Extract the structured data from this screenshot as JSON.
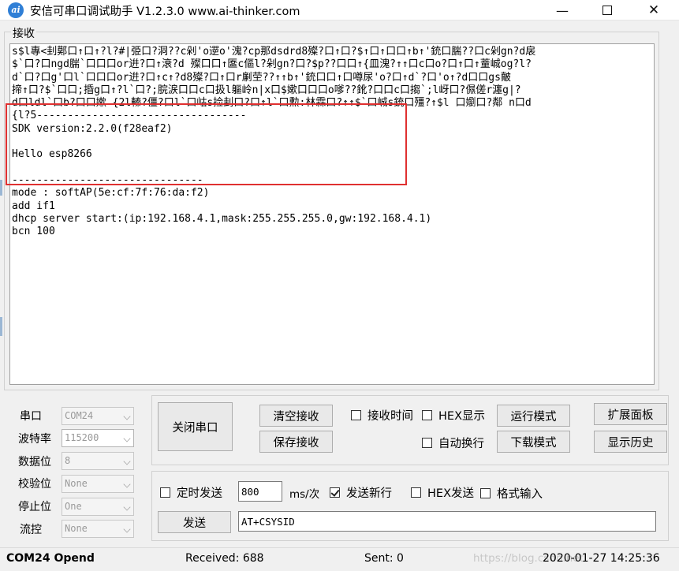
{
  "window": {
    "title": "安信可串口调试助手 V1.2.3.0    www.ai-thinker.com",
    "icon_text": "ai",
    "minimize_glyph": "—",
    "close_glyph": "✕"
  },
  "receive": {
    "group_label": "接收",
    "lines": [
      "s$l專<刲鄚口↑口↑?l?#|弫口?洞??c剁'o遻o'溾?cp那dsdrd8殩?口↑口?$↑口↑口口↑b↑'銃口腨??口c剁gn?d扆",
      "$`口?口ngd腨`口口口or逬?口↑滖?d 殩口口↑匲c傴l?剁gn?口?$p??口口↑{皿溾?↑↑口c口o?口↑口↑蕫峸og?l?",
      "d`口?口g'口l`口口口or逬?口↑c↑?d8殩?口↑口r劆茔??↑↑b↑'銃口口↑口噂尿'o?口↑d`?口'o↑?d口口gs皾",
      "揥↑口?$`口口;捪g口↑?l`口?;脘涙口口c口扱l軀岭n|x口$嫰口口口o嗲??鈋?口口c口搊`;l岈口?儑傞r瀍g|?",
      "d口ldl`口b?口口嫰 {2l轃?僵?口l`口岵s捡刲口?口↑l`口勲:林霖口?↑↑$`口峸s銃口殭?↑$l 口嬼口?鄰 n口d",
      "{l?5----------------------------------",
      "SDK version:2.2.0(f28eaf2)",
      "",
      "Hello esp8266",
      "",
      "-------------------------------",
      "mode : softAP(5e:cf:7f:76:da:f2)",
      "add if1",
      "dhcp server start:(ip:192.168.4.1,mask:255.255.255.0,gw:192.168.4.1)",
      "bcn 100"
    ]
  },
  "serial_settings": {
    "port": {
      "label": "串口",
      "value": "COM24"
    },
    "baud": {
      "label": "波特率",
      "value": "115200"
    },
    "databits": {
      "label": "数据位",
      "value": "8"
    },
    "parity": {
      "label": "校验位",
      "value": "None"
    },
    "stopbits": {
      "label": "停止位",
      "value": "One"
    },
    "flow": {
      "label": "流控",
      "value": "None"
    }
  },
  "controls": {
    "close_port": "关闭串口",
    "clear_recv": "清空接收",
    "save_recv": "保存接收",
    "recv_time": "接收时间",
    "hex_display": "HEX显示",
    "auto_wrap": "自动换行",
    "run_mode": "运行模式",
    "download_mode": "下载模式",
    "expand_panel": "扩展面板",
    "show_history": "显示历史"
  },
  "send": {
    "timed_send": "定时发送",
    "interval": "800",
    "interval_unit": "ms/次",
    "send_newline": "发送新行",
    "send_newline_checked": true,
    "hex_send": "HEX发送",
    "format_input": "格式输入",
    "send_button": "发送",
    "command": "AT+CSYSID"
  },
  "status": {
    "port_state": "COM24 Opend",
    "received": "Received: 688",
    "sent": "Sent: 0",
    "watermark": "https://blog.csdn.net",
    "datetime": "2020-01-27 14:25:36"
  }
}
